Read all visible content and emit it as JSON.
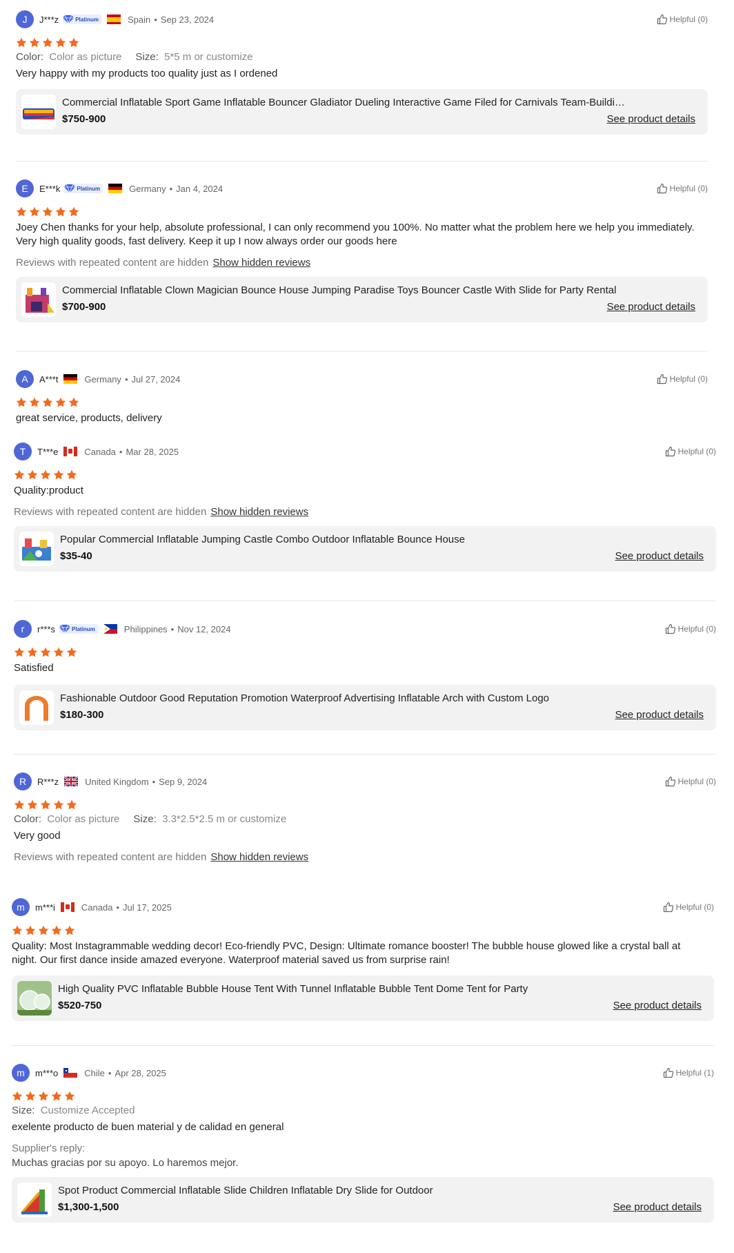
{
  "helpful_prefix": "Helpful",
  "platinum_label": "Platinum",
  "hidden_notice": "Reviews with repeated content are hidden",
  "show_hidden": "Show hidden reviews",
  "see_details": "See product details",
  "colors": {
    "star": "#f26b1d",
    "avatar": "#4f66d6",
    "card_bg": "#f2f2f2"
  },
  "reviews": [
    {
      "initial": "J",
      "user": "J***z",
      "country": "Spain",
      "date": "Sep 23, 2024",
      "helpful": "(0)",
      "attr1_key": "Color:",
      "attr1_val": "Color as picture",
      "attr2_key": "Size:",
      "attr2_val": "5*5 m or customize",
      "text": "Very happy with my products too quality just as I ordened",
      "product": {
        "title": "Commercial Inflatable Sport Game Inflatable Bouncer Gladiator Dueling Interactive Game Filed for Carnivals Team-Building Ev...",
        "price": "$750-900"
      }
    },
    {
      "initial": "E",
      "user": "E***k",
      "country": "Germany",
      "date": "Jan 4, 2024",
      "helpful": "(0)",
      "text": "Joey Chen thanks for your help, absolute professional, I can only recommend you 100%. No matter what the problem here we help you immediately. Very high quality goods, fast delivery. Keep it up I now always order our goods here",
      "product": {
        "title": "Commercial Inflatable Clown Magician Bounce House Jumping Paradise Toys Bouncer Castle With Slide for Party Rental",
        "price": "$700-900"
      }
    },
    {
      "initial": "A",
      "user": "A***t",
      "country": "Germany",
      "date": "Jul 27, 2024",
      "helpful": "(0)",
      "text": "great service, products, delivery"
    },
    {
      "initial": "T",
      "user": "T***e",
      "country": "Canada",
      "date": "Mar 28, 2025",
      "helpful": "(0)",
      "text": "Quality:product",
      "product": {
        "title": "Popular Commercial Inflatable Jumping Castle Combo Outdoor Inflatable Bounce House",
        "price": "$35-40"
      }
    },
    {
      "initial": "r",
      "user": "r***s",
      "country": "Philippines",
      "date": "Nov 12, 2024",
      "helpful": "(0)",
      "text": "Satisfied",
      "product": {
        "title": "Fashionable Outdoor Good Reputation Promotion Waterproof Advertising Inflatable Arch with Custom Logo",
        "price": "$180-300"
      }
    },
    {
      "initial": "R",
      "user": "R***z",
      "country": "United Kingdom",
      "date": "Sep 9, 2024",
      "helpful": "(0)",
      "attr1_key": "Color:",
      "attr1_val": "Color as picture",
      "attr2_key": "Size:",
      "attr2_val": "3.3*2.5*2.5 m or customize",
      "text": "Very good"
    },
    {
      "initial": "m",
      "user": "m***i",
      "country": "Canada",
      "date": "Jul 17, 2025",
      "helpful": "(0)",
      "text": "Quality: Most Instagrammable wedding decor! Eco-friendly PVC,  Design: Ultimate romance booster! The bubble house glowed like a crystal ball at night. Our first dance inside amazed everyone. Waterproof material saved us from surprise rain!",
      "product": {
        "title": "High Quality PVC Inflatable Bubble House Tent With Tunnel Inflatable Bubble Tent Dome Tent for Party",
        "price": "$520-750"
      }
    },
    {
      "initial": "m",
      "user": "m***o",
      "country": "Chile",
      "date": "Apr 28, 2025",
      "helpful": "(1)",
      "attr1_key": "Size:",
      "attr1_val": "Customize Accepted",
      "text": "exelente producto de buen material y de calidad en general",
      "reply_label": "Supplier's reply:",
      "reply_text": "Muchas gracias por su apoyo. Lo haremos mejor.",
      "product": {
        "title": "Spot Product Commercial Inflatable Slide Children Inflatable Dry Slide for Outdoor",
        "price": "$1,300-1,500"
      }
    }
  ]
}
